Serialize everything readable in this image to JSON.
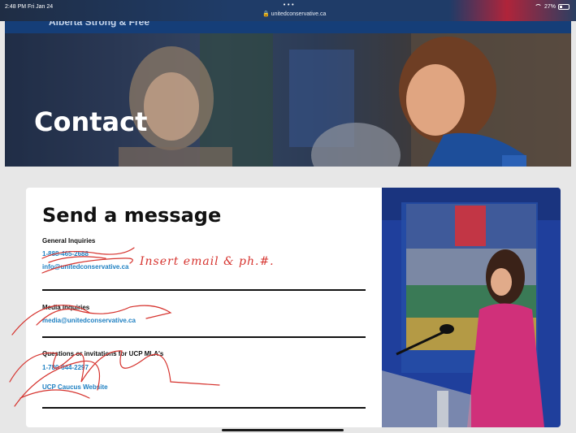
{
  "status_bar": {
    "time": "2:48 PM  Fri Jan 24",
    "dots": "•••",
    "url": "unitedconservative.ca",
    "battery": "27%"
  },
  "header": {
    "site_name": "Alberta Strong & Free"
  },
  "hero": {
    "title": "Contact"
  },
  "form": {
    "title": "Send a message",
    "sections": [
      {
        "heading": "General Inquiries",
        "links": [
          "1-888-465-2688",
          "info@unitedconservative.ca"
        ]
      },
      {
        "heading": "Media Inquiries",
        "links": [
          "media@unitedconservative.ca"
        ]
      },
      {
        "heading": "Questions or invitations for UCP MLA's",
        "links": [
          "1-780-644-2297",
          "UCP Caucus Website"
        ]
      }
    ]
  },
  "annotation": {
    "note": "Insert email & ph.#.",
    "color": "#d6332e"
  },
  "colors": {
    "link": "#1f80c2",
    "navy": "#153e78",
    "accent_pink": "#d0307a"
  }
}
